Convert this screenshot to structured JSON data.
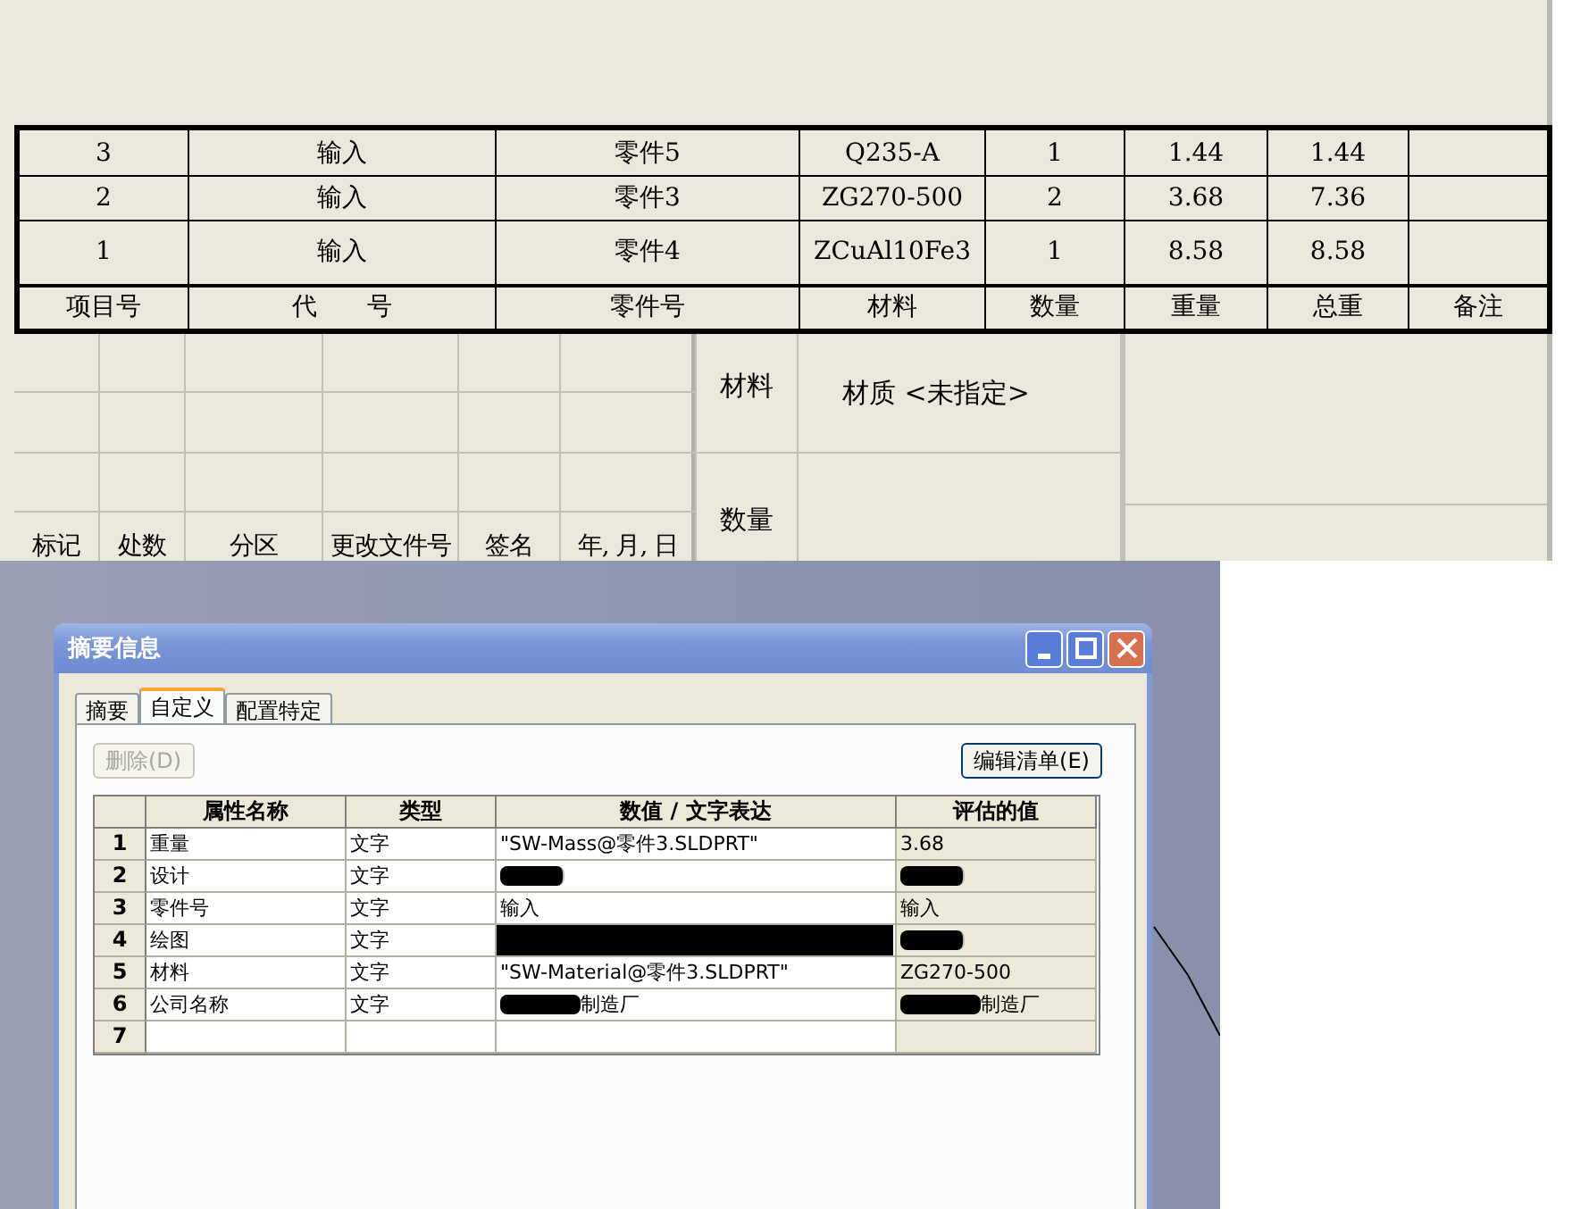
{
  "drawing": {
    "bom_rows": [
      {
        "item": "3",
        "code": "输入",
        "part": "零件5",
        "material": "Q235-A",
        "qty": "1",
        "weight": "1.44",
        "total": "1.44"
      },
      {
        "item": "2",
        "code": "输入",
        "part": "零件3",
        "material": "ZG270-500",
        "qty": "2",
        "weight": "3.68",
        "total": "7.36"
      },
      {
        "item": "1",
        "code": "输入",
        "part": "零件4",
        "material": "ZCuAl10Fe3",
        "qty": "1",
        "weight": "8.58",
        "total": "8.58"
      }
    ],
    "bom_header": [
      "项目号",
      "代　　号",
      "零件号",
      "材料",
      "数量",
      "重量",
      "总重",
      "备注"
    ],
    "title_block": {
      "revision_labels": [
        "标记",
        "处数",
        "分区",
        "更改文件号",
        "签名",
        "年, 月, 日"
      ],
      "material_label": "材料",
      "material_value": "材质 <未指定>",
      "quantity_label": "数量"
    }
  },
  "dialog": {
    "title": "摘要信息",
    "tabs": [
      {
        "label": "摘要",
        "selected": false
      },
      {
        "label": "自定义",
        "selected": true
      },
      {
        "label": "配置特定",
        "selected": false
      }
    ],
    "delete_button": {
      "label": "删除(D)",
      "disabled": true
    },
    "edit_button": {
      "label": "编辑清单(E)",
      "disabled": false
    },
    "table": {
      "columns": [
        "属性名称",
        "类型",
        "数值 / 文字表达",
        "评估的值"
      ],
      "rows": [
        {
          "num": "1",
          "name": "重量",
          "type": "文字",
          "value": "\"SW-Mass@零件3.SLDPRT\"",
          "evaluated": "3.68"
        },
        {
          "num": "2",
          "name": "设计",
          "type": "文字",
          "value_redacted": true,
          "evaluated_redacted": true
        },
        {
          "num": "3",
          "name": "零件号",
          "type": "文字",
          "value": "输入",
          "evaluated": "输入"
        },
        {
          "num": "4",
          "name": "绘图",
          "type": "文字",
          "value_redacted": true,
          "evaluated_redacted": true
        },
        {
          "num": "5",
          "name": "材料",
          "type": "文字",
          "value": "\"SW-Material@零件3.SLDPRT\"",
          "evaluated": "ZG270-500"
        },
        {
          "num": "6",
          "name": "公司名称",
          "type": "文字",
          "value": "制造厂",
          "value_redacted": true,
          "evaluated": "制造厂",
          "evaluated_redacted": true
        },
        {
          "num": "7"
        }
      ]
    }
  }
}
